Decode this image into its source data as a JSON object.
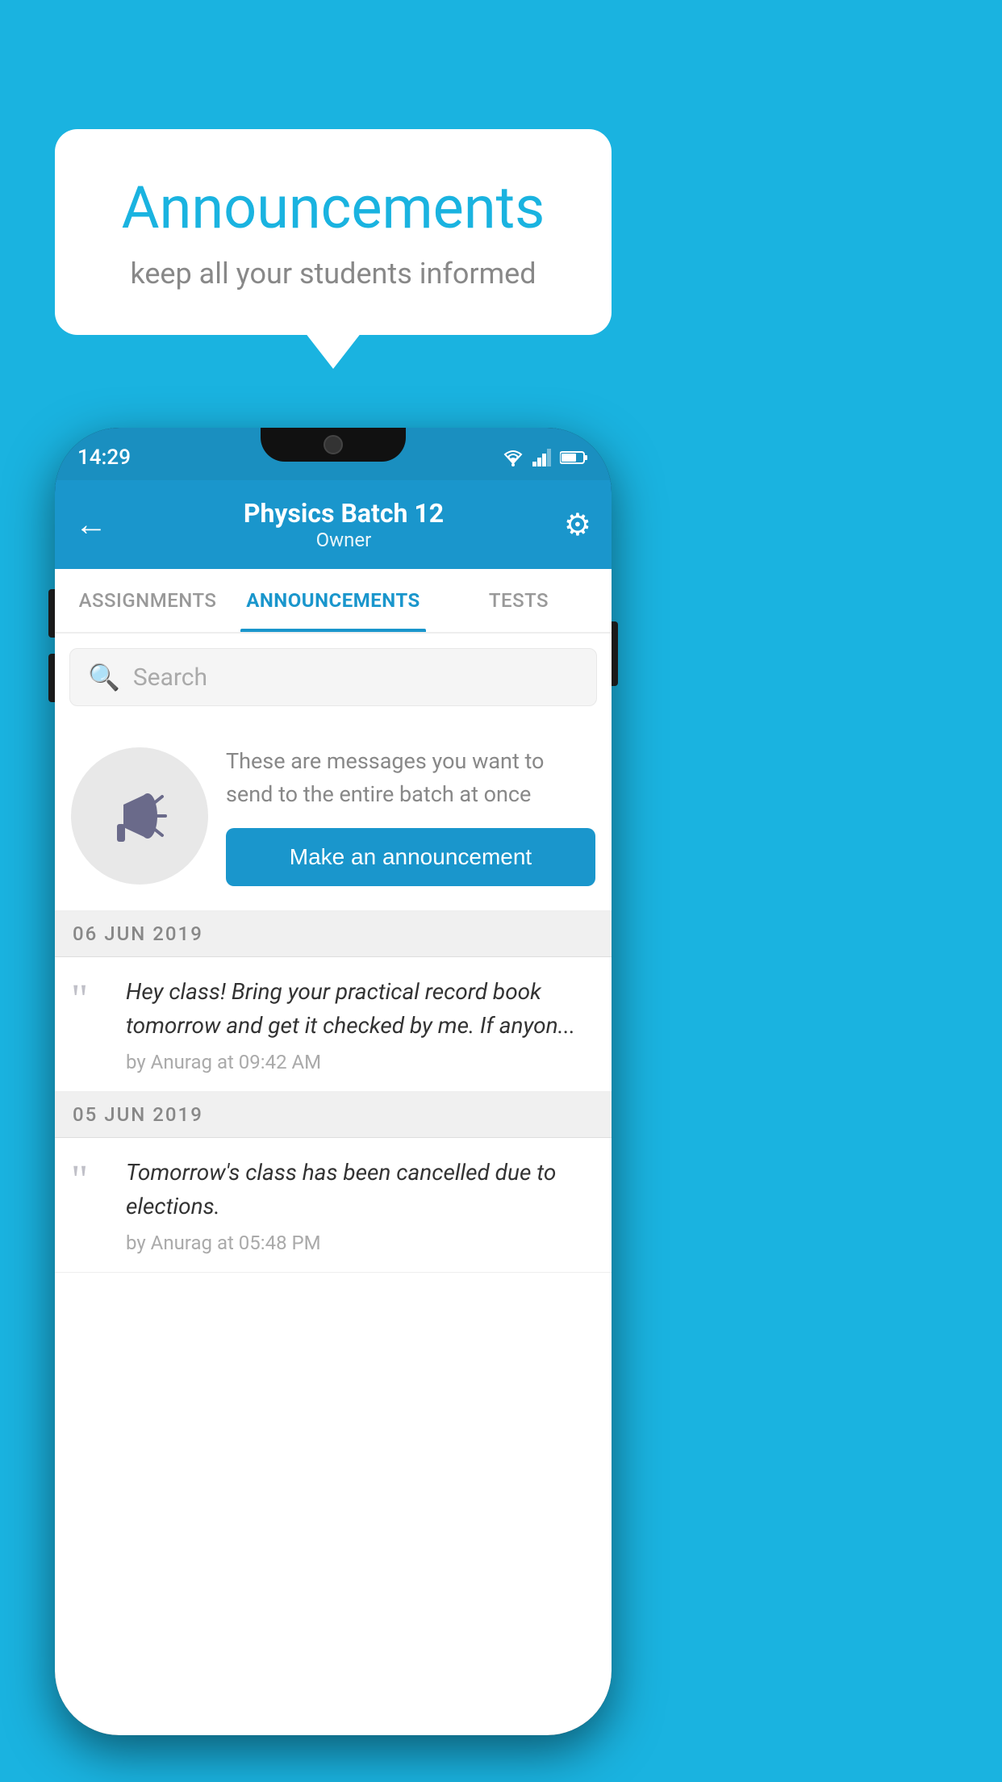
{
  "bubble": {
    "title": "Announcements",
    "subtitle": "keep all your students informed"
  },
  "statusBar": {
    "time": "14:29"
  },
  "header": {
    "back_label": "←",
    "batch_name": "Physics Batch 12",
    "role": "Owner",
    "settings_icon": "⚙"
  },
  "tabs": [
    {
      "label": "ASSIGNMENTS",
      "active": false
    },
    {
      "label": "ANNOUNCEMENTS",
      "active": true
    },
    {
      "label": "TESTS",
      "active": false
    }
  ],
  "search": {
    "placeholder": "Search"
  },
  "emptyState": {
    "description": "These are messages you want to send to the entire batch at once",
    "button_label": "Make an announcement"
  },
  "announcements": [
    {
      "date": "06  JUN  2019",
      "text": "Hey class! Bring your practical record book tomorrow and get it checked by me. If anyon...",
      "meta": "by Anurag at 09:42 AM"
    },
    {
      "date": "05  JUN  2019",
      "text": "Tomorrow's class has been cancelled due to elections.",
      "meta": "by Anurag at 05:48 PM"
    }
  ],
  "colors": {
    "brand_blue": "#1a96cc",
    "bg_blue": "#1ab3e0"
  }
}
